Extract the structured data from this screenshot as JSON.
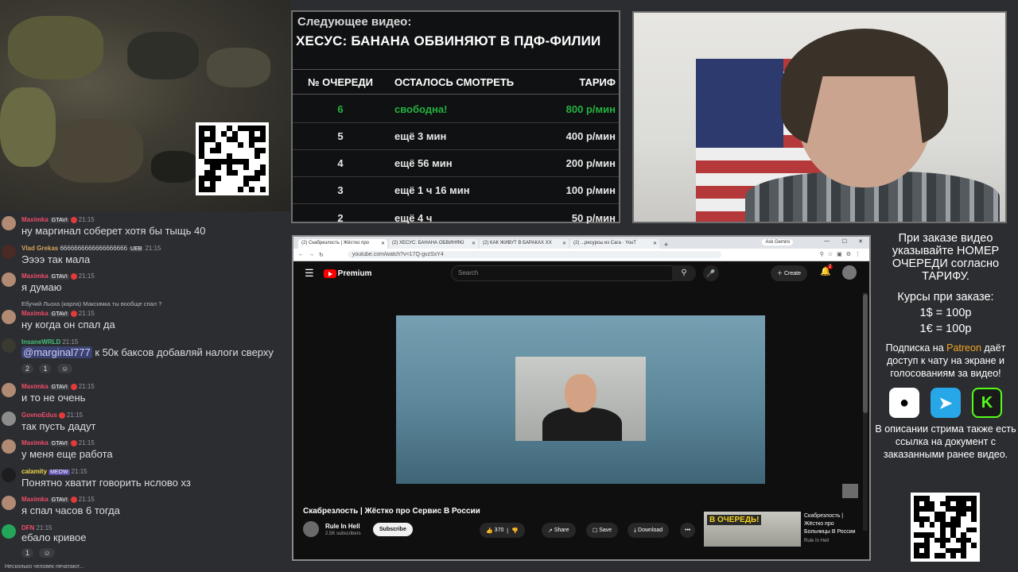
{
  "queue": {
    "next_label": "Следующее видео:",
    "next_title": "ХЕСУС: БАНАНА ОБВИНЯЮТ В ПДФ-ФИЛИИ",
    "headers": [
      "№ ОЧЕРЕДИ",
      "ОСТАЛОСЬ СМОТРЕТЬ",
      "ТАРИФ"
    ],
    "rows": [
      {
        "num": "6",
        "remaining": "свободна!",
        "rate": "800 р/мин"
      },
      {
        "num": "5",
        "remaining": "ещё 3 мин",
        "rate": "400 р/мин"
      },
      {
        "num": "4",
        "remaining": "ещё 56 мин",
        "rate": "200 р/мин"
      },
      {
        "num": "3",
        "remaining": "ещё 1 ч 16 мин",
        "rate": "100 р/мин"
      },
      {
        "num": "2",
        "remaining": "ещё 4 ч",
        "rate": "50 р/мин"
      }
    ],
    "free_color": "#23b341"
  },
  "chat": {
    "messages": [
      {
        "user": "Maximka",
        "user_color": "#f04d6a",
        "badge": "GTAVI",
        "time": "21:15",
        "text": "ну маргинал соберет хотя бы тыщь 40"
      },
      {
        "user": "Vlad Grekas",
        "user_color": "#d6a35a",
        "badge": "UEB",
        "time": "21:15",
        "text": "Ээээ так мала",
        "prefix": "6666666666666666666"
      },
      {
        "user": "Maximka",
        "user_color": "#f04d6a",
        "badge": "GTAVI",
        "time": "21:15",
        "text": "я думаю"
      },
      {
        "reply": "Ебучий Льоха (карла)  Максимка ты вообще спал ?",
        "user": "Maximka",
        "user_color": "#f04d6a",
        "badge": "GTAVI",
        "time": "21:15",
        "text": "ну когда он спал да"
      },
      {
        "user": "InsaneWRLD",
        "user_color": "#45c07a",
        "time": "21:15",
        "mention": "@marginal777",
        "text": " к 50к баксов добавляй налоги сверху",
        "reactions": [
          "2",
          "1",
          ""
        ]
      },
      {
        "user": "Maximka",
        "user_color": "#f04d6a",
        "badge": "GTAVI",
        "time": "21:15",
        "text": "и то не очень"
      },
      {
        "user": "GovnoEdus",
        "user_color": "#f04d6a",
        "time": "21:15",
        "text": "так пусть дадут"
      },
      {
        "user": "Maximka",
        "user_color": "#f04d6a",
        "badge": "GTAVI",
        "time": "21:15",
        "text": "у меня еще работа"
      },
      {
        "user": "calamity",
        "user_color": "#f2d64b",
        "badge": "MEOW",
        "time": "21:15",
        "text": "Понятно хватит говорить нслово хз"
      },
      {
        "user": "Maximka",
        "user_color": "#f04d6a",
        "badge": "GTAVI",
        "time": "21:15",
        "text": "я спал часов 6 тогда"
      },
      {
        "user": "DFN",
        "user_color": "#f04d6a",
        "time": "21:15",
        "text": "ебало кривое",
        "reactions": [
          "1",
          ""
        ]
      }
    ],
    "typing": "Несколько человек печатают..."
  },
  "browser": {
    "tabs": [
      "(2) Скабрезлость | Жёстко про",
      "(2) ХЕСУС: БАНАНА ОБВИНЯЮ",
      "(2) КАК ЖИВУТ В БАРАКАХ XX",
      "(2) ...ресурсы из Сага · YouT"
    ],
    "ask_gemini": "Ask Gemini",
    "url": "youtube.com/watch?v=17Q-gvzSxY4",
    "yt_brand": "Premium",
    "search_placeholder": "Search",
    "create_label": "Create",
    "bell_count": "2",
    "video_title": "Скабрезлость | Жёстко про Сервис В России",
    "channel_name": "Rule In Hell",
    "channel_subs": "2.5K subscribers",
    "subscribe_label": "Subscribe",
    "like_count": "370",
    "share_label": "Share",
    "save_label": "Save",
    "download_label": "Download",
    "more_label": "•••",
    "rec_badge": "В ОЧЕРЕДЬ!",
    "rec_title": "Скабрезлость | Жёстко про Больницы В России",
    "rec_channel": "Rule In Hell"
  },
  "info": {
    "order_note": "При заказе видео указывайте НОМЕР ОЧЕРЕДИ согласно ТАРИФУ.",
    "rates_title": "Курсы при заказе:",
    "rate_usd": "1$ = 100р",
    "rate_eur": "1€ = 100р",
    "sub_pre": "Подписка на ",
    "sub_link": "Patreon",
    "sub_post": " даёт доступ к чату на экране и голосованиям за видео!",
    "desc": "В описании стрима также есть ссылка на документ с заказанными ранее видео.",
    "social_icons": [
      "patreon-icon",
      "telegram-icon",
      "kick-icon"
    ]
  }
}
